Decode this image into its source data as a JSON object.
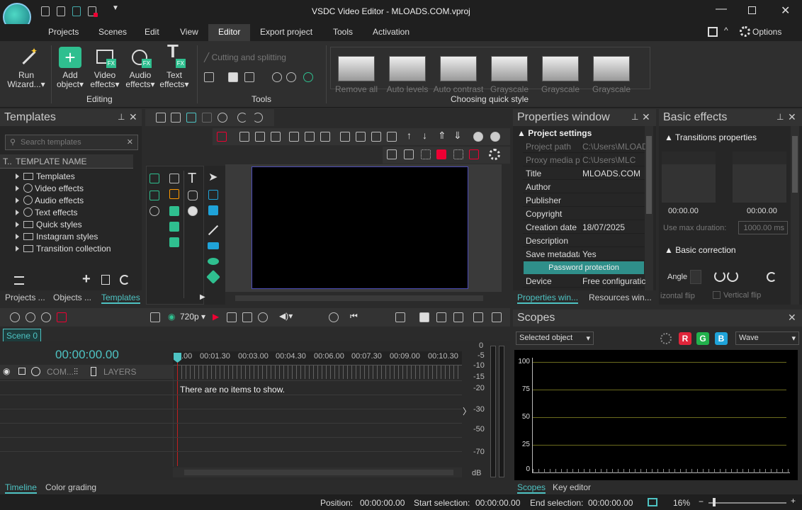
{
  "app": {
    "title": "VSDC Video Editor - MLOADS.COM.vproj"
  },
  "menu": {
    "items": [
      "Projects",
      "Scenes",
      "Edit",
      "View",
      "Editor",
      "Export project",
      "Tools",
      "Activation"
    ],
    "options_label": "Options"
  },
  "ribbon": {
    "run_wizard": "Run\nWizard...",
    "add_object": [
      "Add",
      "object"
    ],
    "video_effects": [
      "Video",
      "effects"
    ],
    "audio_effects": [
      "Audio",
      "effects"
    ],
    "text_effects": [
      "Text",
      "effects"
    ],
    "editing_label": "Editing",
    "cutting": "Cutting and splitting",
    "tools_label": "Tools",
    "quick_styles": [
      "Remove all",
      "Auto levels",
      "Auto contrast",
      "Grayscale",
      "Grayscale",
      "Grayscale"
    ],
    "quick_style_label": "Choosing quick style"
  },
  "templates": {
    "title": "Templates",
    "search_placeholder": "Search templates",
    "col_t": "T..",
    "col_name": "TEMPLATE NAME",
    "items": [
      "Templates",
      "Video effects",
      "Audio effects",
      "Text effects",
      "Quick styles",
      "Instagram styles",
      "Transition collection"
    ],
    "tabs": [
      "Projects ...",
      "Objects ...",
      "Templates"
    ]
  },
  "properties": {
    "title": "Properties window",
    "section": "Project settings",
    "rows": [
      {
        "k": "Project path",
        "v": "C:\\Users\\MLOAD"
      },
      {
        "k": "Proxy media p",
        "v": "C:\\Users\\MLC"
      },
      {
        "k": "Title",
        "v": "MLOADS.COM"
      },
      {
        "k": "Author",
        "v": ""
      },
      {
        "k": "Publisher",
        "v": ""
      },
      {
        "k": "Copyright",
        "v": ""
      },
      {
        "k": "Creation date",
        "v": "18/07/2025"
      },
      {
        "k": "Description",
        "v": ""
      },
      {
        "k": "Save metadata",
        "v": "Yes"
      }
    ],
    "password_btn": "Password protection",
    "device": {
      "k": "Device",
      "v": "Free configuratic"
    },
    "tabs": [
      "Properties win...",
      "Resources win..."
    ]
  },
  "basic_effects": {
    "title": "Basic effects",
    "transitions": "Transitions properties",
    "time1": "00:00.00",
    "time2": "00:00.00",
    "use_max": "Use max duration:",
    "max_val": "1000.00 ms",
    "basic_correction": "Basic correction",
    "angle": "Angle",
    "hflip": "izontal flip",
    "vflip": "Vertical flip"
  },
  "timeline": {
    "scene_tab": "Scene 0",
    "time": "00:00:00.00",
    "resolution": "720p",
    "col_com": "COM...",
    "col_layers": "LAYERS",
    "empty": "There are no items to show.",
    "ticks": [
      ".00",
      "00:01.30",
      "00:03.00",
      "00:04.30",
      "00:06.00",
      "00:07.30",
      "00:09.00",
      "00:10.30"
    ],
    "db": [
      "0",
      "-5",
      "-10",
      "-15",
      "-20",
      "-30",
      "-50",
      "-70",
      "dB"
    ],
    "tabs": [
      "Timeline",
      "Color grading"
    ]
  },
  "scopes": {
    "title": "Scopes",
    "selected": "Selected object",
    "mode": "Wave",
    "ylabels": [
      "100",
      "75",
      "50",
      "25",
      "0"
    ],
    "tabs": [
      "Scopes",
      "Key editor"
    ],
    "channels": [
      "R",
      "G",
      "B"
    ]
  },
  "status": {
    "position_label": "Position:",
    "position": "00:00:00.00",
    "start_label": "Start selection:",
    "start": "00:00:00.00",
    "end_label": "End selection:",
    "end": "00:00:00.00",
    "zoom": "16%"
  },
  "colors": {
    "accent": "#4ec3c3",
    "add_green": "#2fbf8f",
    "red": "#e0253a",
    "green": "#22b14c",
    "blue": "#1fa3d9"
  }
}
